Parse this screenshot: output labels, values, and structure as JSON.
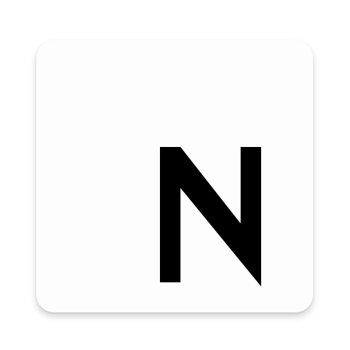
{
  "app_icon": {
    "logo_letter": "N",
    "logo_icon": "n-letter-logo-icon",
    "tile_color": "#fdfdfd",
    "logo_color": "#000000"
  }
}
